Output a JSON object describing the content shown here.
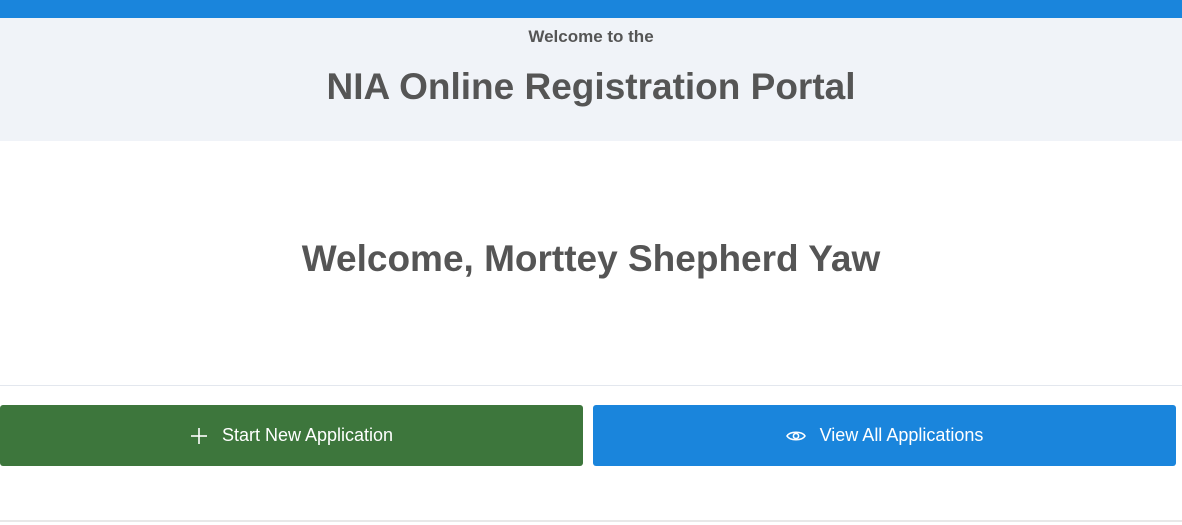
{
  "header": {
    "subtitle": "Welcome to the",
    "title": "NIA Online Registration Portal"
  },
  "main": {
    "welcome_text": "Welcome, Morttey Shepherd Yaw"
  },
  "actions": {
    "start_new": {
      "label": "Start New Application",
      "icon": "plus-icon"
    },
    "view_all": {
      "label": "View All Applications",
      "icon": "eye-icon"
    }
  },
  "colors": {
    "top_bar": "#1a85dc",
    "start_button": "#3d763c",
    "view_button": "#1a85dc",
    "hero_background": "#f0f3f8"
  }
}
